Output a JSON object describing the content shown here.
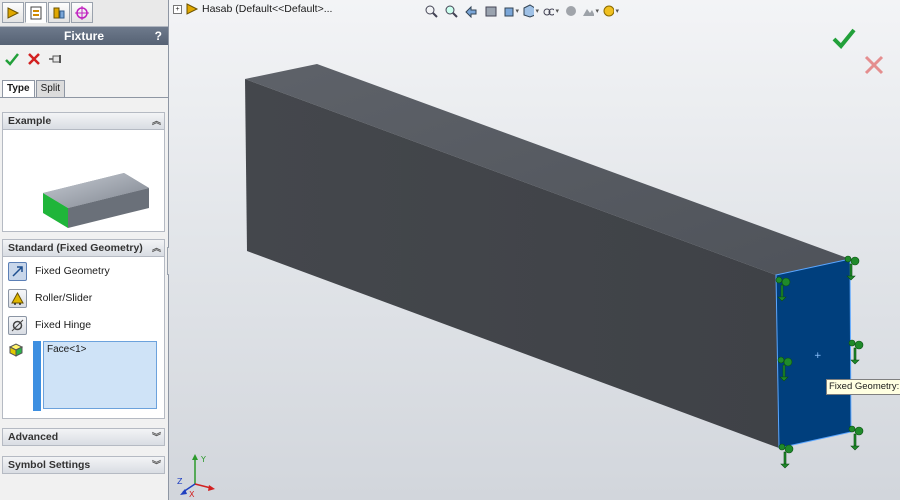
{
  "property_manager": {
    "title": "Fixture",
    "help_label": "?",
    "tabs": [
      "feature-manager-icon",
      "property-manager-icon",
      "configuration-manager-icon",
      "dimxpert-icon"
    ],
    "type_tabs": [
      "Type",
      "Split"
    ],
    "groups": {
      "example": {
        "title": "Example"
      },
      "standard": {
        "title": "Standard (Fixed Geometry)",
        "options": [
          "Fixed Geometry",
          "Roller/Slider",
          "Fixed Hinge"
        ],
        "selected_option": "Fixed Geometry",
        "selection_list": [
          "Face<1>"
        ]
      },
      "advanced": {
        "title": "Advanced"
      },
      "symbol_settings": {
        "title": "Symbol Settings"
      }
    }
  },
  "viewport": {
    "tree_root": "Hasab  (Default<<Default>...",
    "tooltip": "Fixed Geometry:",
    "toolbar_icons": [
      "zoom-to-fit-icon",
      "zoom-to-area-icon",
      "previous-view-icon",
      "section-view-icon",
      "view-orientation-icon",
      "display-style-icon",
      "hide-show-items-icon",
      "edit-appearance-icon",
      "apply-scene-icon",
      "view-settings-icon"
    ]
  },
  "colors": {
    "accent": "#3d8fe1",
    "selected_face": "#003f7d",
    "fixture_symbol": "#1f8a2a",
    "ok": "#22a03a",
    "cancel": "#e05a5a"
  }
}
